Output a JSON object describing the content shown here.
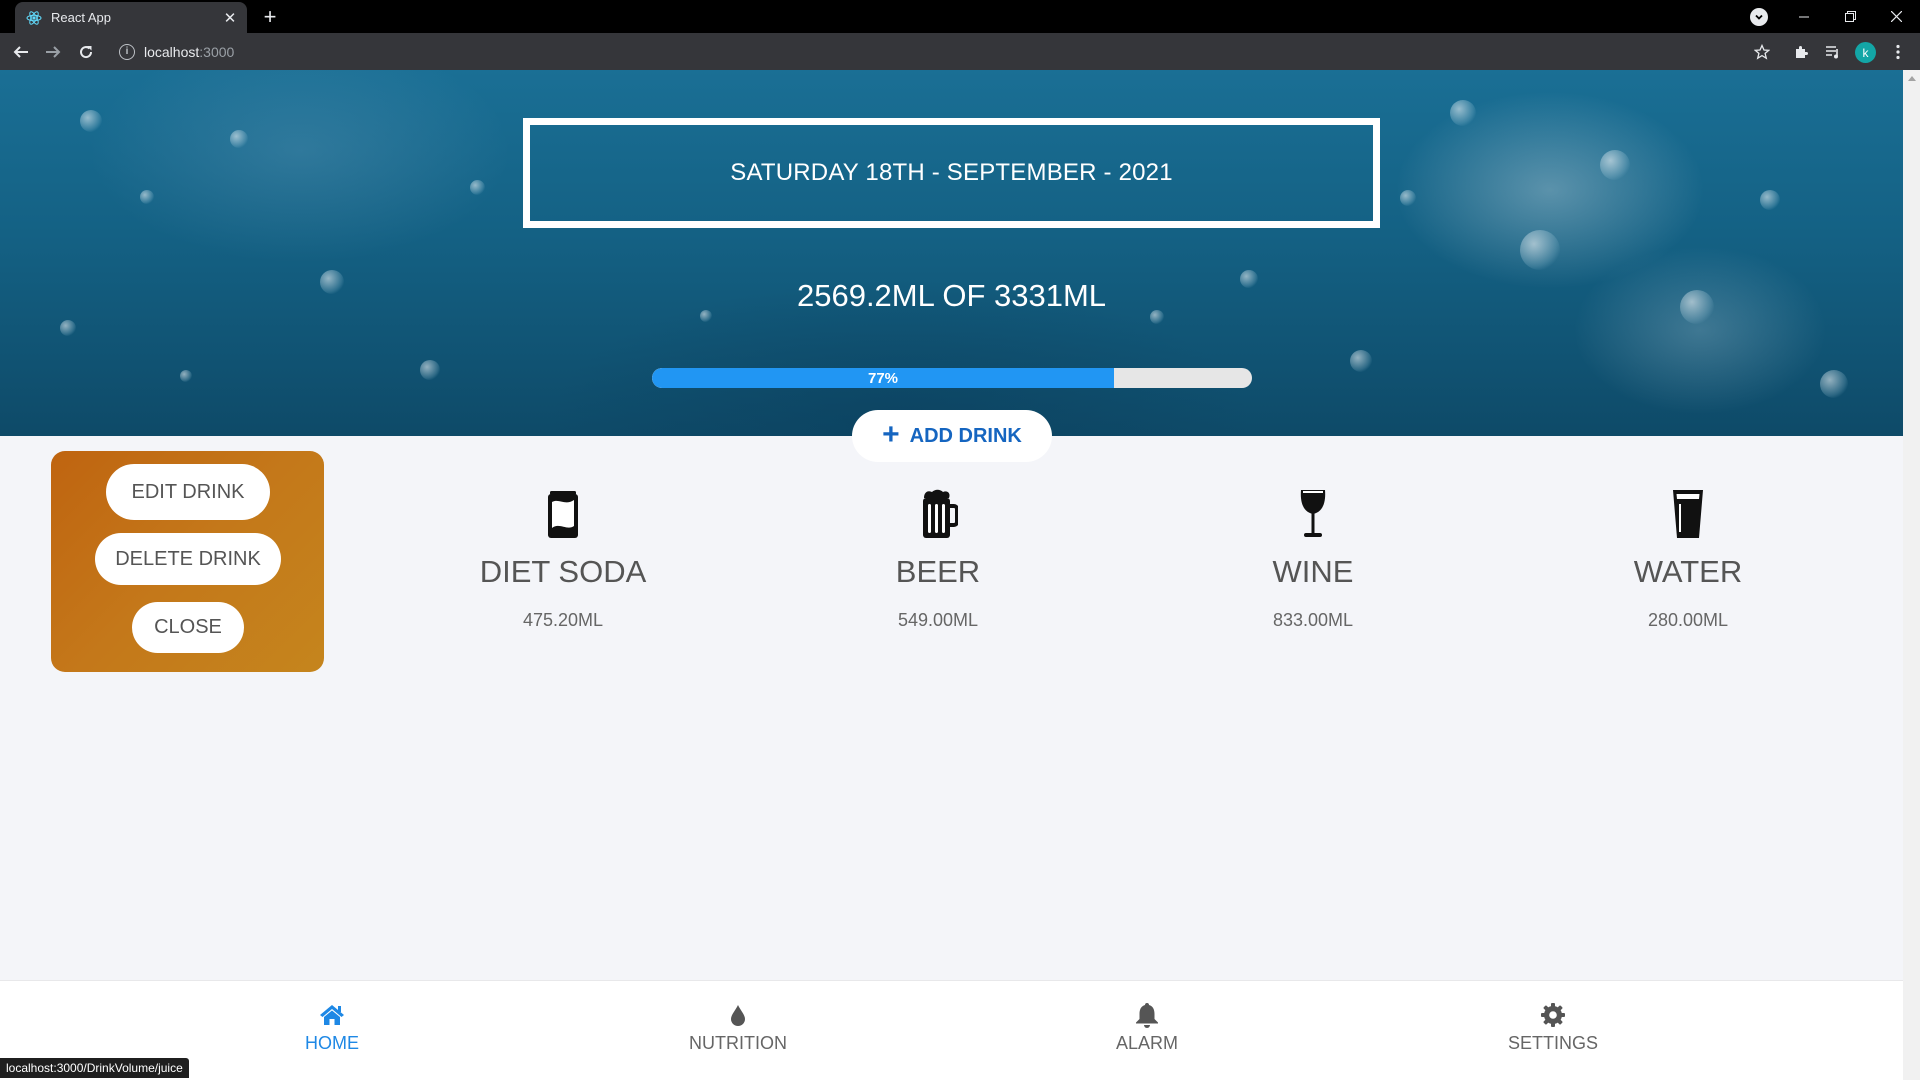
{
  "browser": {
    "tab_title": "React App",
    "url_host": "localhost",
    "url_port": ":3000",
    "status_url": "localhost:3000/DrinkVolume/juice",
    "profile_initial": "k"
  },
  "header": {
    "date": "SATURDAY 18TH - SEPTEMBER - 2021",
    "total": "2569.2ML OF 3331ML",
    "progress_label": "77%",
    "progress_value": 0.77
  },
  "actions": {
    "add_drink": "ADD DRINK"
  },
  "menu": {
    "edit": "EDIT DRINK",
    "delete": "DELETE DRINK",
    "close": "CLOSE"
  },
  "drinks": [
    {
      "name": "DIET SODA",
      "volume": "475.20ML",
      "icon": "soda-can-icon"
    },
    {
      "name": "BEER",
      "volume": "549.00ML",
      "icon": "beer-mug-icon"
    },
    {
      "name": "WINE",
      "volume": "833.00ML",
      "icon": "wine-glass-icon"
    },
    {
      "name": "WATER",
      "volume": "280.00ML",
      "icon": "water-glass-icon"
    }
  ],
  "nav": [
    {
      "label": "HOME",
      "icon": "home-icon",
      "active": true
    },
    {
      "label": "NUTRITION",
      "icon": "drop-icon",
      "active": false
    },
    {
      "label": "ALARM",
      "icon": "bell-icon",
      "active": false
    },
    {
      "label": "SETTINGS",
      "icon": "gear-icon",
      "active": false
    }
  ],
  "colors": {
    "accent": "#1e88e5",
    "progress": "#2196f3",
    "menu_card": "#c4781a"
  }
}
